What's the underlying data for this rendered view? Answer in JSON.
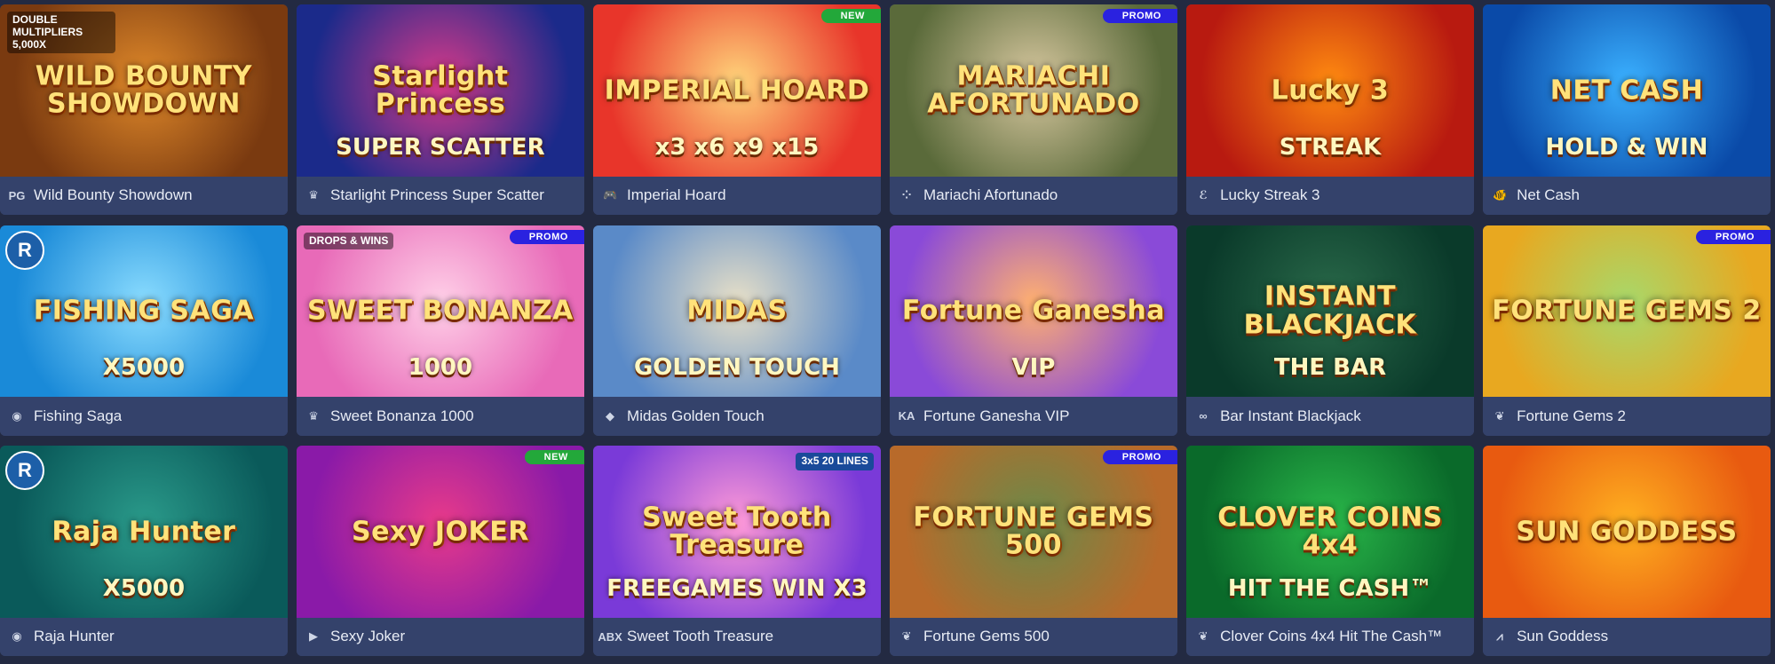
{
  "games": [
    {
      "name": "Wild Bounty Showdown",
      "provider_icon": "pg-logo-icon",
      "provider_text": "PG",
      "art_title": "WILD BOUNTY SHOWDOWN",
      "art_sub": "",
      "badge": "",
      "bg": "#7a3a10",
      "bg2": "#e0892a",
      "extra": "DOUBLE MULTIPLIERS 5,000X"
    },
    {
      "name": "Starlight Princess Super Scatter",
      "provider_icon": "pragmatic-logo-icon",
      "provider_text": "♛",
      "art_title": "Starlight Princess",
      "art_sub": "SUPER SCATTER",
      "badge": "",
      "bg": "#1b2a8a",
      "bg2": "#d83a8a",
      "extra": ""
    },
    {
      "name": "Imperial Hoard",
      "provider_icon": "gamepad-icon",
      "provider_text": "🎮",
      "art_title": "IMPERIAL HOARD",
      "art_sub": "x3 x6 x9 x15",
      "badge": "NEW",
      "bg": "#e8352a",
      "bg2": "#ffd37a",
      "extra": ""
    },
    {
      "name": "Mariachi Afortunado",
      "provider_icon": "dots-logo-icon",
      "provider_text": "⁘",
      "art_title": "MARIACHI AFORTUNADO",
      "art_sub": "",
      "badge": "PROMO",
      "bg": "#5a6a3a",
      "bg2": "#d8c8a0",
      "extra": ""
    },
    {
      "name": "Lucky Streak 3",
      "provider_icon": "endorphina-logo-icon",
      "provider_text": "ℰ",
      "art_title": "Lucky 3",
      "art_sub": "STREAK",
      "badge": "",
      "bg": "#b81a10",
      "bg2": "#ff8a10",
      "extra": ""
    },
    {
      "name": "Net Cash",
      "provider_icon": "fish-logo-icon",
      "provider_text": "🐠",
      "art_title": "NET CASH",
      "art_sub": "HOLD & WIN",
      "badge": "",
      "bg": "#0a4aa8",
      "bg2": "#3ab0ff",
      "extra": ""
    },
    {
      "name": "Fishing Saga",
      "provider_icon": "provider-circle-icon",
      "provider_text": "◉",
      "art_title": "FISHING SAGA",
      "art_sub": "X5000",
      "badge": "",
      "bg": "#1a8ad8",
      "bg2": "#8adcff",
      "extra": ""
    },
    {
      "name": "Sweet Bonanza 1000",
      "provider_icon": "pragmatic-logo-icon",
      "provider_text": "♛",
      "art_title": "SWEET BONANZA",
      "art_sub": "1000",
      "badge": "PROMO",
      "bg": "#e86ab8",
      "bg2": "#ffd0e8",
      "extra": "DROPS & WINS"
    },
    {
      "name": "Midas Golden Touch",
      "provider_icon": "thunderkick-logo-icon",
      "provider_text": "◆",
      "art_title": "MIDAS",
      "art_sub": "GOLDEN TOUCH",
      "badge": "",
      "bg": "#5a8ac8",
      "bg2": "#e8e0c8",
      "extra": ""
    },
    {
      "name": "Fortune Ganesha VIP",
      "provider_icon": "ka-gaming-logo-icon",
      "provider_text": "KA",
      "art_title": "Fortune Ganesha",
      "art_sub": "VIP",
      "badge": "",
      "bg": "#8a4ad8",
      "bg2": "#ffb070",
      "extra": ""
    },
    {
      "name": "Bar Instant Blackjack",
      "provider_icon": "infinity-logo-icon",
      "provider_text": "∞",
      "art_title": "INSTANT BLACKJACK",
      "art_sub": "THE BAR",
      "badge": "",
      "bg": "#0a3a2a",
      "bg2": "#2a6a4a",
      "extra": ""
    },
    {
      "name": "Fortune Gems 2",
      "provider_icon": "jili-logo-icon",
      "provider_text": "❦",
      "art_title": "FORTUNE GEMS 2",
      "art_sub": "",
      "badge": "PROMO",
      "bg": "#e8a820",
      "bg2": "#a8d86a",
      "extra": ""
    },
    {
      "name": "Raja Hunter",
      "provider_icon": "provider-circle-icon",
      "provider_text": "◉",
      "art_title": "Raja Hunter",
      "art_sub": "X5000",
      "badge": "",
      "bg": "#0a5a5a",
      "bg2": "#2a9a8a",
      "extra": ""
    },
    {
      "name": "Sexy Joker",
      "provider_icon": "play-logo-icon",
      "provider_text": "▶",
      "art_title": "Sexy JOKER",
      "art_sub": "",
      "badge": "NEW",
      "bg": "#8a1aa8",
      "bg2": "#e83a8a",
      "extra": ""
    },
    {
      "name": "Sweet Tooth Treasure",
      "provider_icon": "abx-logo-icon",
      "provider_text": "ABX",
      "art_title": "Sweet Tooth Treasure",
      "art_sub": "FREEGAMES WIN X3",
      "badge": "",
      "bg": "#7a3ad8",
      "bg2": "#ff9ad8",
      "extra": "3x5 20 LINES"
    },
    {
      "name": "Fortune Gems 500",
      "provider_icon": "jili-logo-icon",
      "provider_text": "❦",
      "art_title": "FORTUNE GEMS 500",
      "art_sub": "",
      "badge": "PROMO",
      "bg": "#b86a2a",
      "bg2": "#6a8a4a",
      "extra": ""
    },
    {
      "name": "Clover Coins 4x4 Hit The Cash™",
      "provider_icon": "jili-logo-icon",
      "provider_text": "❦",
      "art_title": "CLOVER COINS 4x4",
      "art_sub": "HIT THE CASH™",
      "badge": "",
      "bg": "#0a6a2a",
      "bg2": "#2ab84a",
      "extra": ""
    },
    {
      "name": "Sun Goddess",
      "provider_icon": "sun-logo-icon",
      "provider_text": "⩘",
      "art_title": "SUN GODDESS",
      "art_sub": "",
      "badge": "",
      "bg": "#e85a10",
      "bg2": "#ffb020",
      "extra": ""
    }
  ]
}
